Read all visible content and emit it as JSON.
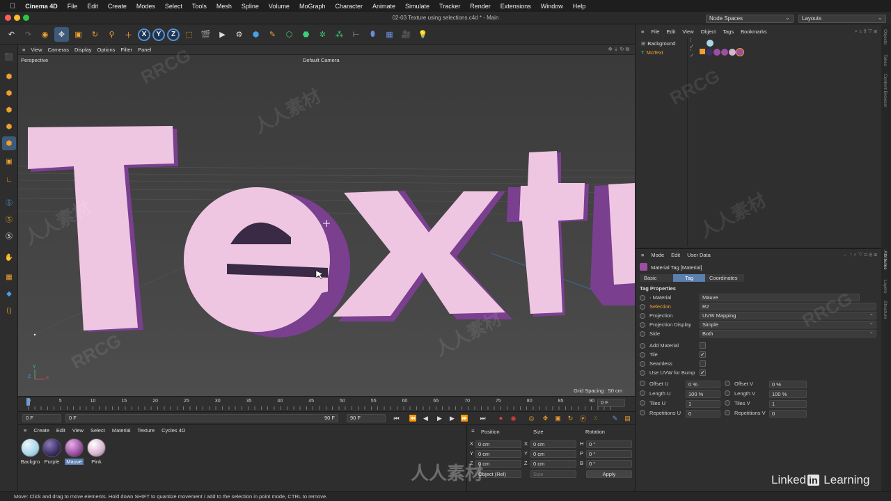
{
  "menubar": {
    "app": "Cinema 4D",
    "items": [
      "File",
      "Edit",
      "Create",
      "Modes",
      "Select",
      "Tools",
      "Mesh",
      "Spline",
      "Volume",
      "MoGraph",
      "Character",
      "Animate",
      "Simulate",
      "Tracker",
      "Render",
      "Extensions",
      "Window",
      "Help"
    ]
  },
  "window": {
    "title": "02-03 Texture using selections.c4d * - Main",
    "node_spaces": "Node Spaces",
    "layouts": "Layouts"
  },
  "viewport": {
    "menu": [
      "View",
      "Cameras",
      "Display",
      "Options",
      "Filter",
      "Panel"
    ],
    "projection": "Perspective",
    "camera": "Default Camera",
    "grid_spacing": "Grid Spacing : 50 cm",
    "text_3d": "Textu",
    "axis_y": "Y",
    "axis_z": "Z",
    "axis_x": "X"
  },
  "timeline": {
    "ticks": [
      "0",
      "5",
      "10",
      "15",
      "20",
      "25",
      "30",
      "35",
      "40",
      "45",
      "50",
      "55",
      "60",
      "65",
      "70",
      "75",
      "80",
      "85",
      "90"
    ],
    "current_frame": "0 F"
  },
  "transport": {
    "start": "0 F",
    "min": "0 F",
    "max": "90 F",
    "end": "90 F"
  },
  "materials": {
    "menu": [
      "Create",
      "Edit",
      "View",
      "Select",
      "Material",
      "Texture",
      "Cycles 4D"
    ],
    "items": [
      {
        "name": "Backgro",
        "color": "#a9d6e8"
      },
      {
        "name": "Purple",
        "color": "#3b2e63"
      },
      {
        "name": "Mauve",
        "color": "#9b4fa0"
      },
      {
        "name": "Pink",
        "color": "#d8b3cf"
      }
    ],
    "selected": "Mauve"
  },
  "coords": {
    "headers": [
      "Position",
      "Size",
      "Rotation"
    ],
    "rows": [
      {
        "axis": "X",
        "pos": "0 cm",
        "saxis": "X",
        "size": "0 cm",
        "raxis": "H",
        "rot": "0 °"
      },
      {
        "axis": "Y",
        "pos": "0 cm",
        "saxis": "Y",
        "size": "0 cm",
        "raxis": "P",
        "rot": "0 °"
      },
      {
        "axis": "Z",
        "pos": "0 cm",
        "saxis": "Z",
        "size": "0 cm",
        "raxis": "B",
        "rot": "0 °"
      }
    ],
    "mode": "Object (Rel)",
    "size_mode": "Size",
    "apply": "Apply"
  },
  "objects": {
    "menu": [
      "File",
      "Edit",
      "View",
      "Object",
      "Tags",
      "Bookmarks"
    ],
    "items": [
      {
        "name": "Background",
        "color": "#dddddd"
      },
      {
        "name": "MoText",
        "color": "#f0a030"
      }
    ]
  },
  "attributes": {
    "menu": [
      "Mode",
      "Edit",
      "User Data"
    ],
    "title": "Material Tag [Material]",
    "tabs": [
      "Basic",
      "Tag",
      "Coordinates"
    ],
    "active_tab": "Tag",
    "section": "Tag Properties",
    "props": [
      {
        "label": "Material",
        "value": "Mauve"
      },
      {
        "label": "Selection",
        "value": "R2"
      },
      {
        "label": "Projection",
        "value": "UVW Mapping"
      },
      {
        "label": "Projection Display",
        "value": "Simple"
      },
      {
        "label": "Side",
        "value": "Both"
      }
    ],
    "checks": [
      {
        "label": "Add Material",
        "checked": false
      },
      {
        "label": "Tile",
        "checked": true
      },
      {
        "label": "Seamless",
        "checked": false
      },
      {
        "label": "Use UVW for Bump",
        "checked": true
      }
    ],
    "offsets": [
      {
        "l1": "Offset U",
        "v1": "0 %",
        "l2": "Offset V",
        "v2": "0 %"
      },
      {
        "l1": "Length U",
        "v1": "100 %",
        "l2": "Length V",
        "v2": "100 %"
      },
      {
        "l1": "Tiles U",
        "v1": "1",
        "l2": "Tiles V",
        "v2": "1"
      },
      {
        "l1": "Repetitions U",
        "v1": "0",
        "l2": "Repetitions V",
        "v2": "0"
      }
    ]
  },
  "right_tabs": [
    "Objects",
    "Takes",
    "Content Browser",
    "Attributes",
    "Layers",
    "Structure"
  ],
  "status": "Move: Click and drag to move elements. Hold down SHIFT to quantize movement / add to the selection in point mode, CTRL to remove.",
  "branding": {
    "linkedin": "Linked",
    "in": "in",
    "learning": " Learning"
  },
  "watermarks": {
    "rrcg": "RRCG",
    "cn": "人人素材"
  },
  "colors": {
    "accent": "#5b7fae",
    "text_face": "#efc6e2",
    "text_side": "#7a3f8f",
    "selection_label": "#f0a030"
  }
}
